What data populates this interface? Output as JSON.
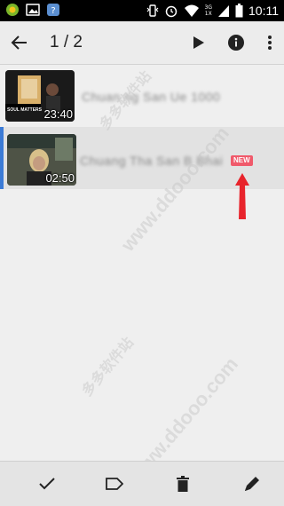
{
  "status_bar": {
    "time": "10:11",
    "net_label_top": "3G",
    "net_label_bottom": "1X"
  },
  "toolbar": {
    "page_indicator": "1 / 2",
    "icons": [
      "back-arrow-icon",
      "play-icon",
      "info-icon",
      "more-vert-icon"
    ]
  },
  "videos": [
    {
      "title": "Chuan ng San Ue 1000",
      "duration": "23:40",
      "thumbnail_overlay": "SOUL MATTERS",
      "is_new": false,
      "selected": false
    },
    {
      "title": "Chuang Tha San B Bhai",
      "title_tail": "ai",
      "duration": "02:50",
      "is_new": true,
      "new_label": "NEW",
      "selected": true
    }
  ],
  "watermarks": [
    "www.ddooo.com",
    "多多软件站"
  ],
  "bottom_bar": {
    "icons": [
      "check-icon",
      "label-icon",
      "delete-icon",
      "edit-icon"
    ]
  },
  "colors": {
    "accent_blue": "#3b7bd6",
    "new_badge": "#f05a6b",
    "annotation_red": "#e8242c"
  }
}
